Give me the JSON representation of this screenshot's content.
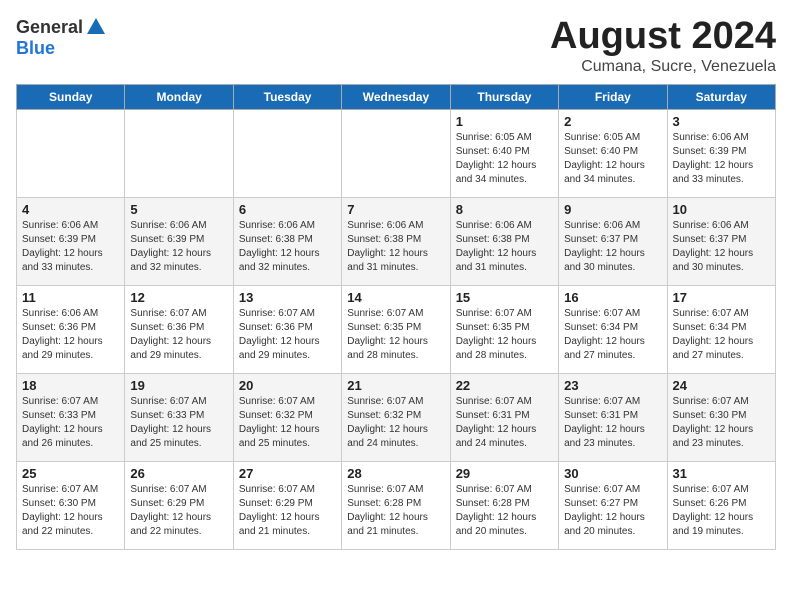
{
  "header": {
    "logo_general": "General",
    "logo_blue": "Blue",
    "title": "August 2024",
    "subtitle": "Cumana, Sucre, Venezuela"
  },
  "days_of_week": [
    "Sunday",
    "Monday",
    "Tuesday",
    "Wednesday",
    "Thursday",
    "Friday",
    "Saturday"
  ],
  "weeks": [
    [
      {
        "day": "",
        "info": ""
      },
      {
        "day": "",
        "info": ""
      },
      {
        "day": "",
        "info": ""
      },
      {
        "day": "",
        "info": ""
      },
      {
        "day": "1",
        "info": "Sunrise: 6:05 AM\nSunset: 6:40 PM\nDaylight: 12 hours\nand 34 minutes."
      },
      {
        "day": "2",
        "info": "Sunrise: 6:05 AM\nSunset: 6:40 PM\nDaylight: 12 hours\nand 34 minutes."
      },
      {
        "day": "3",
        "info": "Sunrise: 6:06 AM\nSunset: 6:39 PM\nDaylight: 12 hours\nand 33 minutes."
      }
    ],
    [
      {
        "day": "4",
        "info": "Sunrise: 6:06 AM\nSunset: 6:39 PM\nDaylight: 12 hours\nand 33 minutes."
      },
      {
        "day": "5",
        "info": "Sunrise: 6:06 AM\nSunset: 6:39 PM\nDaylight: 12 hours\nand 32 minutes."
      },
      {
        "day": "6",
        "info": "Sunrise: 6:06 AM\nSunset: 6:38 PM\nDaylight: 12 hours\nand 32 minutes."
      },
      {
        "day": "7",
        "info": "Sunrise: 6:06 AM\nSunset: 6:38 PM\nDaylight: 12 hours\nand 31 minutes."
      },
      {
        "day": "8",
        "info": "Sunrise: 6:06 AM\nSunset: 6:38 PM\nDaylight: 12 hours\nand 31 minutes."
      },
      {
        "day": "9",
        "info": "Sunrise: 6:06 AM\nSunset: 6:37 PM\nDaylight: 12 hours\nand 30 minutes."
      },
      {
        "day": "10",
        "info": "Sunrise: 6:06 AM\nSunset: 6:37 PM\nDaylight: 12 hours\nand 30 minutes."
      }
    ],
    [
      {
        "day": "11",
        "info": "Sunrise: 6:06 AM\nSunset: 6:36 PM\nDaylight: 12 hours\nand 29 minutes."
      },
      {
        "day": "12",
        "info": "Sunrise: 6:07 AM\nSunset: 6:36 PM\nDaylight: 12 hours\nand 29 minutes."
      },
      {
        "day": "13",
        "info": "Sunrise: 6:07 AM\nSunset: 6:36 PM\nDaylight: 12 hours\nand 29 minutes."
      },
      {
        "day": "14",
        "info": "Sunrise: 6:07 AM\nSunset: 6:35 PM\nDaylight: 12 hours\nand 28 minutes."
      },
      {
        "day": "15",
        "info": "Sunrise: 6:07 AM\nSunset: 6:35 PM\nDaylight: 12 hours\nand 28 minutes."
      },
      {
        "day": "16",
        "info": "Sunrise: 6:07 AM\nSunset: 6:34 PM\nDaylight: 12 hours\nand 27 minutes."
      },
      {
        "day": "17",
        "info": "Sunrise: 6:07 AM\nSunset: 6:34 PM\nDaylight: 12 hours\nand 27 minutes."
      }
    ],
    [
      {
        "day": "18",
        "info": "Sunrise: 6:07 AM\nSunset: 6:33 PM\nDaylight: 12 hours\nand 26 minutes."
      },
      {
        "day": "19",
        "info": "Sunrise: 6:07 AM\nSunset: 6:33 PM\nDaylight: 12 hours\nand 25 minutes."
      },
      {
        "day": "20",
        "info": "Sunrise: 6:07 AM\nSunset: 6:32 PM\nDaylight: 12 hours\nand 25 minutes."
      },
      {
        "day": "21",
        "info": "Sunrise: 6:07 AM\nSunset: 6:32 PM\nDaylight: 12 hours\nand 24 minutes."
      },
      {
        "day": "22",
        "info": "Sunrise: 6:07 AM\nSunset: 6:31 PM\nDaylight: 12 hours\nand 24 minutes."
      },
      {
        "day": "23",
        "info": "Sunrise: 6:07 AM\nSunset: 6:31 PM\nDaylight: 12 hours\nand 23 minutes."
      },
      {
        "day": "24",
        "info": "Sunrise: 6:07 AM\nSunset: 6:30 PM\nDaylight: 12 hours\nand 23 minutes."
      }
    ],
    [
      {
        "day": "25",
        "info": "Sunrise: 6:07 AM\nSunset: 6:30 PM\nDaylight: 12 hours\nand 22 minutes."
      },
      {
        "day": "26",
        "info": "Sunrise: 6:07 AM\nSunset: 6:29 PM\nDaylight: 12 hours\nand 22 minutes."
      },
      {
        "day": "27",
        "info": "Sunrise: 6:07 AM\nSunset: 6:29 PM\nDaylight: 12 hours\nand 21 minutes."
      },
      {
        "day": "28",
        "info": "Sunrise: 6:07 AM\nSunset: 6:28 PM\nDaylight: 12 hours\nand 21 minutes."
      },
      {
        "day": "29",
        "info": "Sunrise: 6:07 AM\nSunset: 6:28 PM\nDaylight: 12 hours\nand 20 minutes."
      },
      {
        "day": "30",
        "info": "Sunrise: 6:07 AM\nSunset: 6:27 PM\nDaylight: 12 hours\nand 20 minutes."
      },
      {
        "day": "31",
        "info": "Sunrise: 6:07 AM\nSunset: 6:26 PM\nDaylight: 12 hours\nand 19 minutes."
      }
    ]
  ]
}
